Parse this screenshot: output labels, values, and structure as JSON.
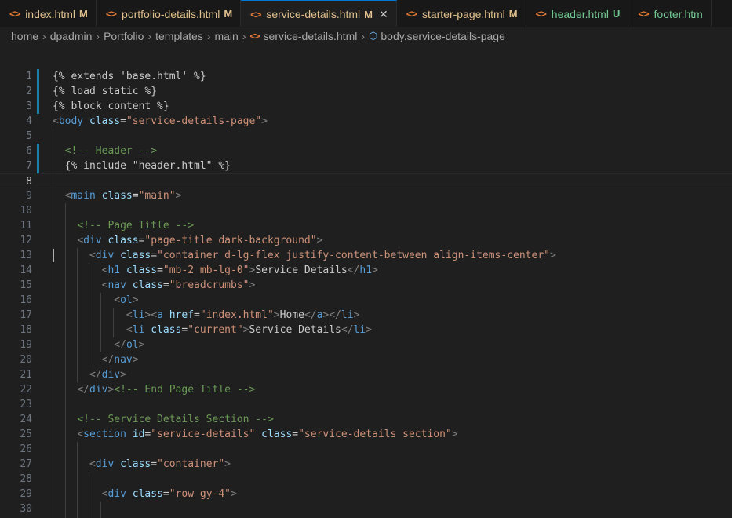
{
  "tabs": [
    {
      "name": "index.html",
      "status": "M",
      "state": "modified"
    },
    {
      "name": "portfolio-details.html",
      "status": "M",
      "state": "modified"
    },
    {
      "name": "service-details.html",
      "status": "M",
      "state": "active"
    },
    {
      "name": "starter-page.html",
      "status": "M",
      "state": "modified"
    },
    {
      "name": "header.html",
      "status": "U",
      "state": "untracked"
    },
    {
      "name": "footer.htm",
      "status": "",
      "state": "untracked"
    }
  ],
  "breadcrumb": [
    "home",
    "dpadmin",
    "Portfolio",
    "templates",
    "main",
    "service-details.html",
    "body.service-details-page"
  ],
  "colors": {
    "accent": "#0078d4",
    "modified": "#e2c08d",
    "untracked": "#73c991",
    "tag": "#569cd6",
    "attribute": "#9cdcfe",
    "string": "#ce9178",
    "comment": "#6a9955"
  },
  "icons": {
    "file": "html-file-icon",
    "close": "close-icon",
    "symbol": "symbol-class-icon"
  },
  "editor": {
    "current_line": 8,
    "lines": [
      {
        "n": 1,
        "parts": [
          [
            "tpl",
            "{% extends 'base.html' %}"
          ]
        ]
      },
      {
        "n": 2,
        "parts": [
          [
            "tpl",
            "{% load static %}"
          ]
        ]
      },
      {
        "n": 3,
        "parts": [
          [
            "tpl",
            "{% block content %}"
          ]
        ]
      },
      {
        "n": 4,
        "parts": [
          [
            "punct",
            "<"
          ],
          [
            "tag",
            "body"
          ],
          [
            "tpl",
            " "
          ],
          [
            "attr",
            "class"
          ],
          [
            "tpl",
            "="
          ],
          [
            "str",
            "\"service-details-page\""
          ],
          [
            "punct",
            ">"
          ]
        ]
      },
      {
        "n": 5,
        "parts": []
      },
      {
        "n": 6,
        "parts": [
          [
            "tpl",
            "  "
          ],
          [
            "cmt",
            "<!-- Header -->"
          ]
        ]
      },
      {
        "n": 7,
        "parts": [
          [
            "tpl",
            "  {% include \"header.html\" %}"
          ]
        ]
      },
      {
        "n": 8,
        "parts": []
      },
      {
        "n": 9,
        "parts": [
          [
            "tpl",
            "  "
          ],
          [
            "punct",
            "<"
          ],
          [
            "tag",
            "main"
          ],
          [
            "tpl",
            " "
          ],
          [
            "attr",
            "class"
          ],
          [
            "tpl",
            "="
          ],
          [
            "str",
            "\"main\""
          ],
          [
            "punct",
            ">"
          ]
        ]
      },
      {
        "n": 10,
        "parts": []
      },
      {
        "n": 11,
        "parts": [
          [
            "tpl",
            "    "
          ],
          [
            "cmt",
            "<!-- Page Title -->"
          ]
        ]
      },
      {
        "n": 12,
        "parts": [
          [
            "tpl",
            "    "
          ],
          [
            "punct",
            "<"
          ],
          [
            "tag",
            "div"
          ],
          [
            "tpl",
            " "
          ],
          [
            "attr",
            "class"
          ],
          [
            "tpl",
            "="
          ],
          [
            "str",
            "\"page-title dark-background\""
          ],
          [
            "punct",
            ">"
          ]
        ]
      },
      {
        "n": 13,
        "parts": [
          [
            "tpl",
            "      "
          ],
          [
            "punct",
            "<"
          ],
          [
            "tag",
            "div"
          ],
          [
            "tpl",
            " "
          ],
          [
            "attr",
            "class"
          ],
          [
            "tpl",
            "="
          ],
          [
            "str",
            "\"container d-lg-flex justify-content-between align-items-center\""
          ],
          [
            "punct",
            ">"
          ]
        ]
      },
      {
        "n": 14,
        "parts": [
          [
            "tpl",
            "        "
          ],
          [
            "punct",
            "<"
          ],
          [
            "tag",
            "h1"
          ],
          [
            "tpl",
            " "
          ],
          [
            "attr",
            "class"
          ],
          [
            "tpl",
            "="
          ],
          [
            "str",
            "\"mb-2 mb-lg-0\""
          ],
          [
            "punct",
            ">"
          ],
          [
            "tpl",
            "Service Details"
          ],
          [
            "punct",
            "</"
          ],
          [
            "tag",
            "h1"
          ],
          [
            "punct",
            ">"
          ]
        ]
      },
      {
        "n": 15,
        "parts": [
          [
            "tpl",
            "        "
          ],
          [
            "punct",
            "<"
          ],
          [
            "tag",
            "nav"
          ],
          [
            "tpl",
            " "
          ],
          [
            "attr",
            "class"
          ],
          [
            "tpl",
            "="
          ],
          [
            "str",
            "\"breadcrumbs\""
          ],
          [
            "punct",
            ">"
          ]
        ]
      },
      {
        "n": 16,
        "parts": [
          [
            "tpl",
            "          "
          ],
          [
            "punct",
            "<"
          ],
          [
            "tag",
            "ol"
          ],
          [
            "punct",
            ">"
          ]
        ]
      },
      {
        "n": 17,
        "parts": [
          [
            "tpl",
            "            "
          ],
          [
            "punct",
            "<"
          ],
          [
            "tag",
            "li"
          ],
          [
            "punct",
            "><"
          ],
          [
            "tag",
            "a"
          ],
          [
            "tpl",
            " "
          ],
          [
            "attr",
            "href"
          ],
          [
            "tpl",
            "="
          ],
          [
            "str",
            "\""
          ],
          [
            "strlink",
            "index.html"
          ],
          [
            "str",
            "\""
          ],
          [
            "punct",
            ">"
          ],
          [
            "tpl",
            "Home"
          ],
          [
            "punct",
            "</"
          ],
          [
            "tag",
            "a"
          ],
          [
            "punct",
            "></"
          ],
          [
            "tag",
            "li"
          ],
          [
            "punct",
            ">"
          ]
        ]
      },
      {
        "n": 18,
        "parts": [
          [
            "tpl",
            "            "
          ],
          [
            "punct",
            "<"
          ],
          [
            "tag",
            "li"
          ],
          [
            "tpl",
            " "
          ],
          [
            "attr",
            "class"
          ],
          [
            "tpl",
            "="
          ],
          [
            "str",
            "\"current\""
          ],
          [
            "punct",
            ">"
          ],
          [
            "tpl",
            "Service Details"
          ],
          [
            "punct",
            "</"
          ],
          [
            "tag",
            "li"
          ],
          [
            "punct",
            ">"
          ]
        ]
      },
      {
        "n": 19,
        "parts": [
          [
            "tpl",
            "          "
          ],
          [
            "punct",
            "</"
          ],
          [
            "tag",
            "ol"
          ],
          [
            "punct",
            ">"
          ]
        ]
      },
      {
        "n": 20,
        "parts": [
          [
            "tpl",
            "        "
          ],
          [
            "punct",
            "</"
          ],
          [
            "tag",
            "nav"
          ],
          [
            "punct",
            ">"
          ]
        ]
      },
      {
        "n": 21,
        "parts": [
          [
            "tpl",
            "      "
          ],
          [
            "punct",
            "</"
          ],
          [
            "tag",
            "div"
          ],
          [
            "punct",
            ">"
          ]
        ]
      },
      {
        "n": 22,
        "parts": [
          [
            "tpl",
            "    "
          ],
          [
            "punct",
            "</"
          ],
          [
            "tag",
            "div"
          ],
          [
            "punct",
            ">"
          ],
          [
            "cmt",
            "<!-- End Page Title -->"
          ]
        ]
      },
      {
        "n": 23,
        "parts": []
      },
      {
        "n": 24,
        "parts": [
          [
            "tpl",
            "    "
          ],
          [
            "cmt",
            "<!-- Service Details Section -->"
          ]
        ]
      },
      {
        "n": 25,
        "parts": [
          [
            "tpl",
            "    "
          ],
          [
            "punct",
            "<"
          ],
          [
            "tag",
            "section"
          ],
          [
            "tpl",
            " "
          ],
          [
            "attr",
            "id"
          ],
          [
            "tpl",
            "="
          ],
          [
            "str",
            "\"service-details\""
          ],
          [
            "tpl",
            " "
          ],
          [
            "attr",
            "class"
          ],
          [
            "tpl",
            "="
          ],
          [
            "str",
            "\"service-details section\""
          ],
          [
            "punct",
            ">"
          ]
        ]
      },
      {
        "n": 26,
        "parts": []
      },
      {
        "n": 27,
        "parts": [
          [
            "tpl",
            "      "
          ],
          [
            "punct",
            "<"
          ],
          [
            "tag",
            "div"
          ],
          [
            "tpl",
            " "
          ],
          [
            "attr",
            "class"
          ],
          [
            "tpl",
            "="
          ],
          [
            "str",
            "\"container\""
          ],
          [
            "punct",
            ">"
          ]
        ]
      },
      {
        "n": 28,
        "parts": []
      },
      {
        "n": 29,
        "parts": [
          [
            "tpl",
            "        "
          ],
          [
            "punct",
            "<"
          ],
          [
            "tag",
            "div"
          ],
          [
            "tpl",
            " "
          ],
          [
            "attr",
            "class"
          ],
          [
            "tpl",
            "="
          ],
          [
            "str",
            "\"row gy-4\""
          ],
          [
            "punct",
            ">"
          ]
        ]
      },
      {
        "n": 30,
        "parts": []
      }
    ]
  }
}
